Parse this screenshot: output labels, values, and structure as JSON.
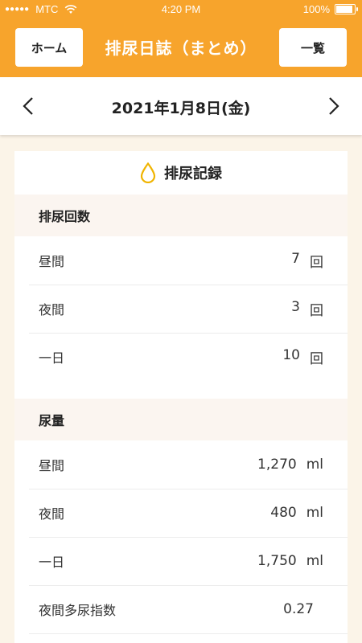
{
  "status_bar": {
    "carrier": "MTC",
    "signal_dots": "●●●●●",
    "time": "4:20 PM",
    "battery": "100%",
    "battery_level": 1.0
  },
  "nav": {
    "left_button": "ホーム",
    "title": "排尿日誌（まとめ）",
    "right_button": "一覧"
  },
  "date_bar": {
    "date": "2021年1月8日(金)",
    "prev_icon": "chevron-left-icon",
    "next_icon": "chevron-right-icon"
  },
  "card": {
    "title": "排尿記録",
    "title_icon": "droplet-icon",
    "title_icon_color": "#f0b400",
    "sections": [
      {
        "header": "排尿回数",
        "rows": [
          {
            "label": "昼間",
            "value": "7",
            "unit": "回"
          },
          {
            "label": "夜間",
            "value": "3",
            "unit": "回"
          },
          {
            "label": "一日",
            "value": "10",
            "unit": "回"
          }
        ]
      },
      {
        "header": "尿量",
        "rows": [
          {
            "label": "昼間",
            "value": "1,270",
            "unit": "ml"
          },
          {
            "label": "夜間",
            "value": "480",
            "unit": "ml"
          },
          {
            "label": "一日",
            "value": "1,750",
            "unit": "ml"
          },
          {
            "label": "夜間多尿指数",
            "value": "0.27",
            "unit": ""
          }
        ]
      }
    ]
  },
  "colors": {
    "accent": "#f7a42c",
    "background": "#fbf4e8",
    "section_bg": "#fbf5f0"
  }
}
